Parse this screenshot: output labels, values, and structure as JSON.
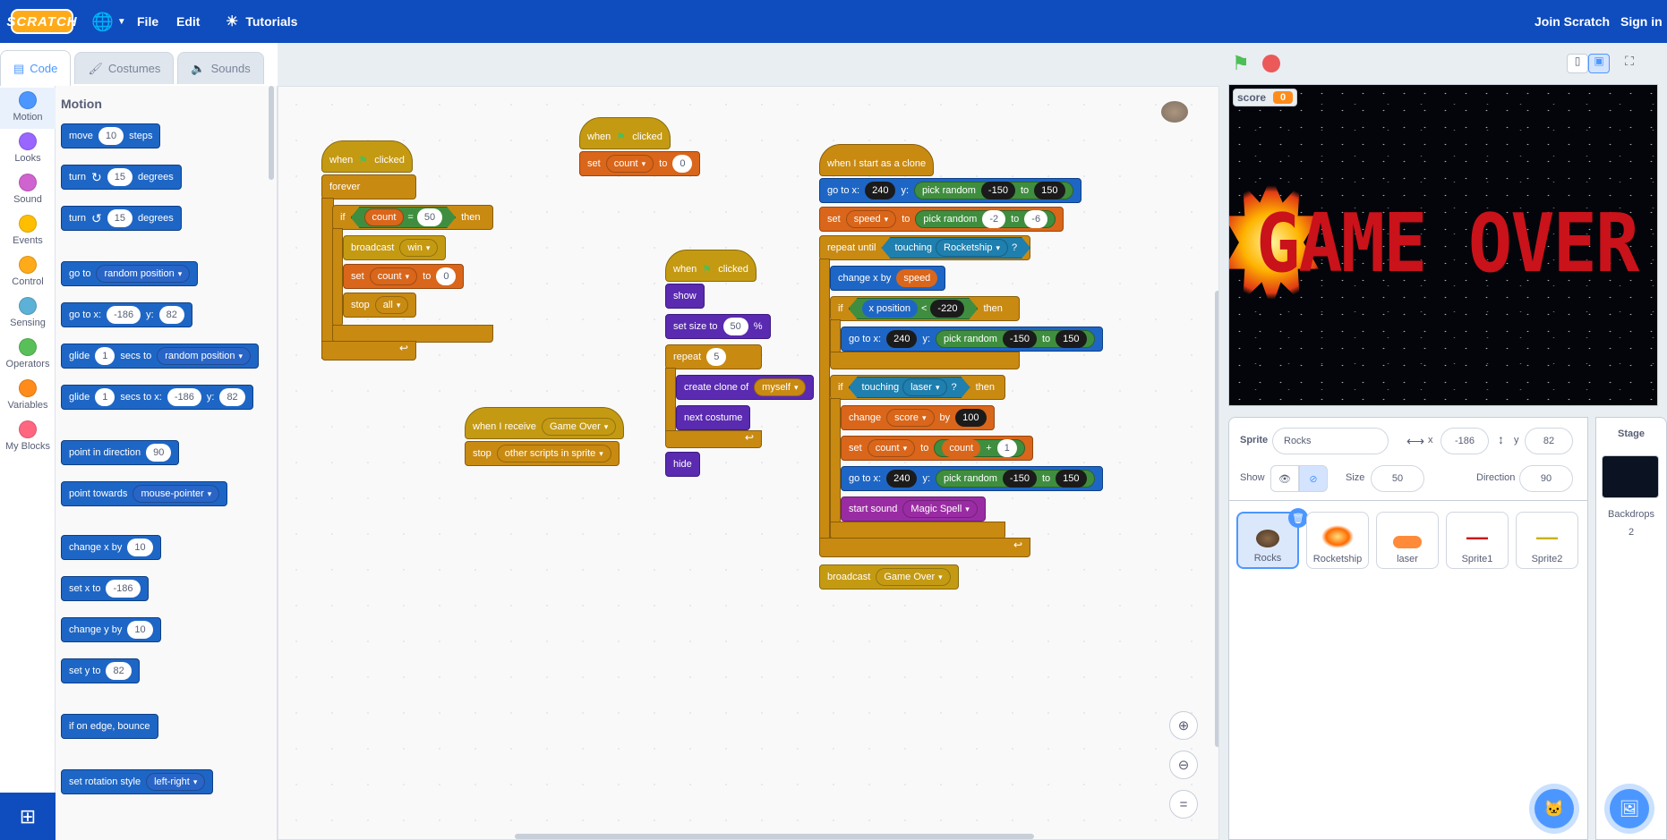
{
  "menubar": {
    "logo": "SCRATCH",
    "file": "File",
    "edit": "Edit",
    "tutorials": "Tutorials",
    "join": "Join Scratch",
    "signin": "Sign in"
  },
  "tabs": {
    "code": "Code",
    "costumes": "Costumes",
    "sounds": "Sounds"
  },
  "categories": [
    "Motion",
    "Looks",
    "Sound",
    "Events",
    "Control",
    "Sensing",
    "Operators",
    "Variables",
    "My Blocks"
  ],
  "category_colors": [
    "#4c97ff",
    "#9966ff",
    "#cf63cf",
    "#ffbf00",
    "#ffab19",
    "#5cb1d6",
    "#59c059",
    "#ff8c1a",
    "#ff6680"
  ],
  "palette": {
    "title": "Motion",
    "move": [
      "move",
      "10",
      "steps"
    ],
    "turn_r": [
      "turn",
      "15",
      "degrees"
    ],
    "turn_l": [
      "turn",
      "15",
      "degrees"
    ],
    "goto": [
      "go to",
      "random position"
    ],
    "gotoxy": [
      "go to x:",
      "-186",
      "y:",
      "82"
    ],
    "glide1": [
      "glide",
      "1",
      "secs to",
      "random position"
    ],
    "glide2": [
      "glide",
      "1",
      "secs to x:",
      "-186",
      "y:",
      "82"
    ],
    "point_dir": [
      "point in direction",
      "90"
    ],
    "point_tow": [
      "point towards",
      "mouse-pointer"
    ],
    "changex": [
      "change x by",
      "10"
    ],
    "setx": [
      "set x to",
      "-186"
    ],
    "changey": [
      "change y by",
      "10"
    ],
    "sety": [
      "set y to",
      "82"
    ],
    "bounce": "if on edge, bounce",
    "rotstyle": [
      "set rotation style",
      "left-right"
    ]
  },
  "scripts": {
    "s1": {
      "when": "when",
      "clicked": "clicked",
      "forever": "forever",
      "if": "if",
      "count": "count",
      "eq": "=",
      "val": "50",
      "then": "then",
      "broadcast": "broadcast",
      "win": "win",
      "set": "set",
      "setvar": "count",
      "to": "to",
      "zero": "0",
      "stop": "stop",
      "all": "all"
    },
    "s2": {
      "when": "when",
      "clicked": "clicked",
      "set": "set",
      "var": "count",
      "to": "to",
      "val": "0"
    },
    "s3": {
      "when": "when I receive",
      "msg": "Game Over",
      "stop": "stop",
      "opt": "other scripts in sprite"
    },
    "s4": {
      "when": "when",
      "clicked": "clicked",
      "show": "show",
      "setsize": "set size to",
      "size": "50",
      "pct": "%",
      "repeat": "repeat",
      "times": "5",
      "clone": "create clone of",
      "myself": "myself",
      "next": "next costume",
      "hide": "hide"
    },
    "s5": {
      "hat": "when I start as a clone",
      "goto": [
        "go to x:",
        "240",
        "y:",
        "pick random",
        "-150",
        "to",
        "150"
      ],
      "set": [
        "set",
        "speed",
        "to",
        "pick random",
        "-2",
        "to",
        "-6"
      ],
      "repeat": [
        "repeat until",
        "touching",
        "Rocketship",
        "?"
      ],
      "changex": [
        "change x by",
        "speed"
      ],
      "if1": [
        "if",
        "x position",
        "<",
        "-220",
        "then"
      ],
      "goto2": [
        "go to x:",
        "240",
        "y:",
        "pick random",
        "-150",
        "to",
        "150"
      ],
      "if2": [
        "if",
        "touching",
        "laser",
        "?",
        "then"
      ],
      "change": [
        "change",
        "score",
        "by",
        "100"
      ],
      "set2": [
        "set",
        "count",
        "to",
        "count",
        "+",
        "1"
      ],
      "goto3": [
        "go to x:",
        "240",
        "y:",
        "pick random",
        "-150",
        "to",
        "150"
      ],
      "sound": [
        "start sound",
        "Magic Spell"
      ],
      "broadcast": [
        "broadcast",
        "Game Over"
      ]
    }
  },
  "stage": {
    "monitor_label": "score",
    "monitor_value": "0",
    "text": "GAME OVER"
  },
  "sprite_info": {
    "sprite_label": "Sprite",
    "name": "Rocks",
    "x_label": "x",
    "x": "-186",
    "y_label": "y",
    "y": "82",
    "show": "Show",
    "size_label": "Size",
    "size": "50",
    "dir_label": "Direction",
    "dir": "90"
  },
  "sprites": [
    "Rocks",
    "Rocketship",
    "laser",
    "Sprite1",
    "Sprite2"
  ],
  "stage_panel": {
    "title": "Stage",
    "backdrops_label": "Backdrops",
    "backdrops_count": "2"
  }
}
